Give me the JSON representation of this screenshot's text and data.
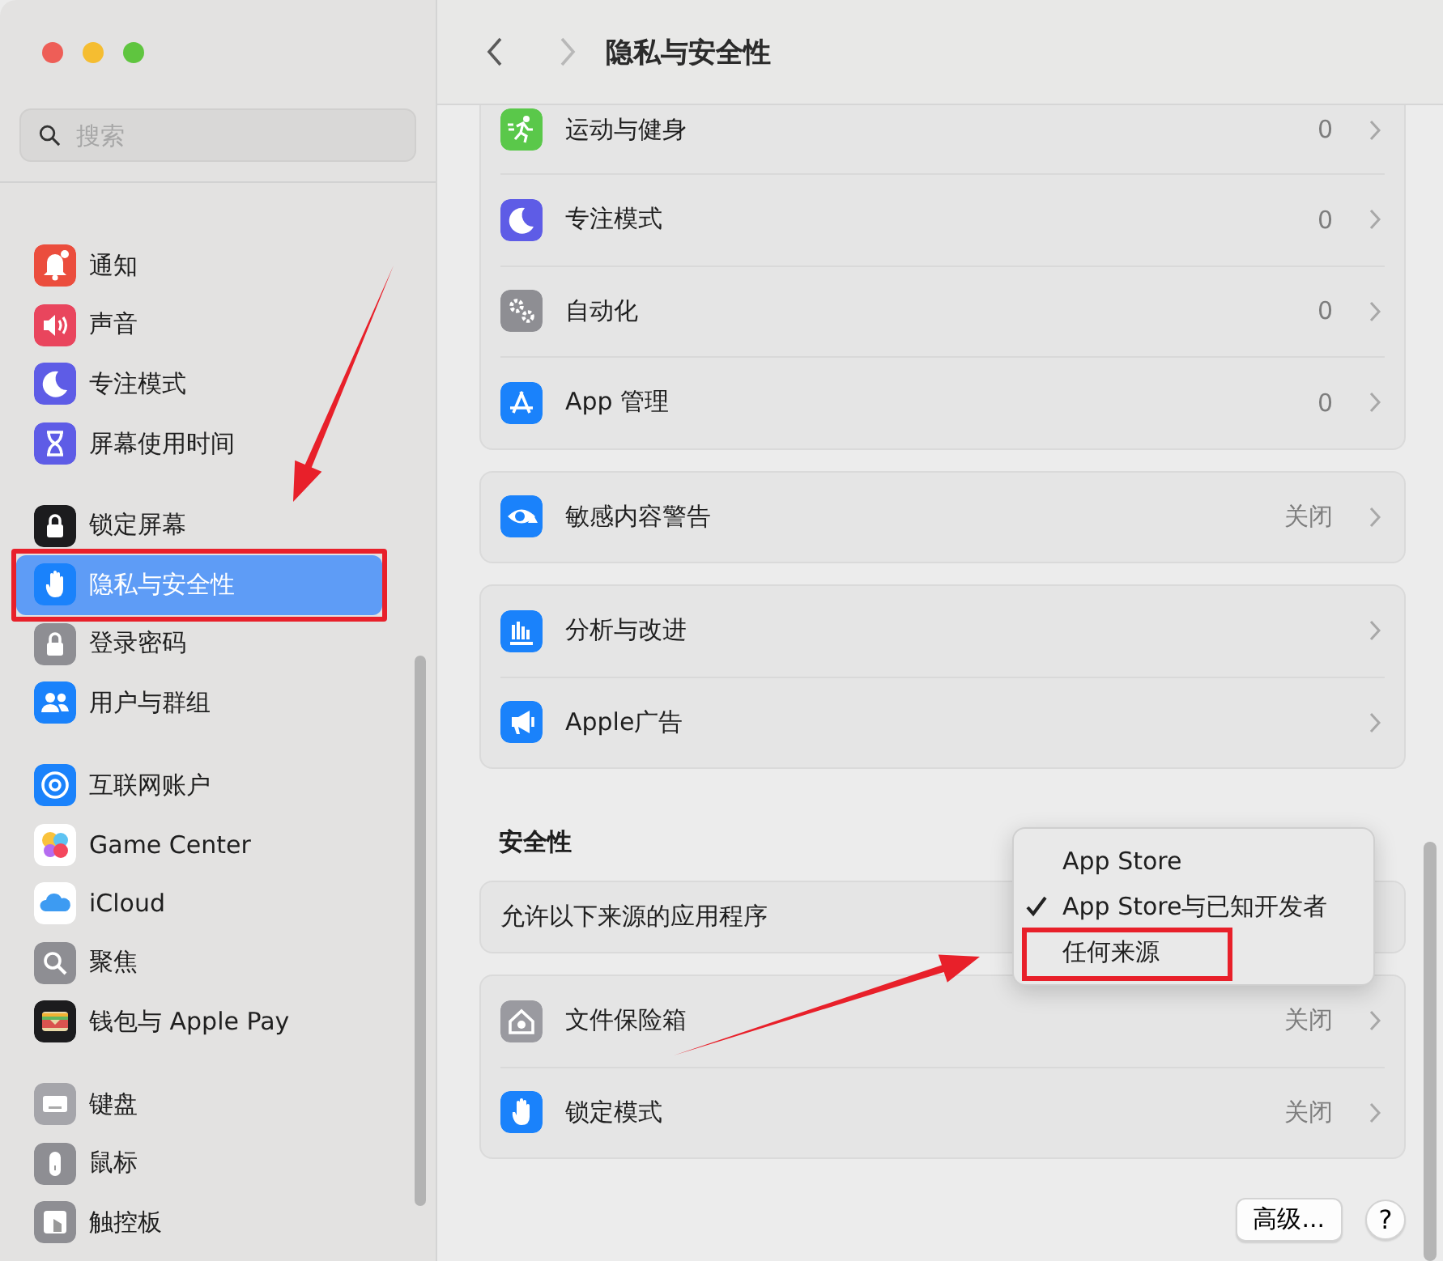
{
  "window": {
    "controls": [
      {
        "kind": "close"
      },
      {
        "kind": "minimize"
      },
      {
        "kind": "zoom"
      }
    ]
  },
  "sidebar": {
    "search": {
      "placeholder": "搜索"
    },
    "groups": [
      {
        "items": [
          {
            "label": "通知",
            "selected": false,
            "marked": false
          },
          {
            "label": "声音",
            "selected": false,
            "marked": false
          },
          {
            "label": "专注模式",
            "selected": false,
            "marked": false
          },
          {
            "label": "屏幕使用时间",
            "selected": false,
            "marked": false
          }
        ]
      },
      {
        "items": [
          {
            "label": "锁定屏幕",
            "selected": false,
            "marked": false
          },
          {
            "label": "隐私与安全性",
            "selected": true,
            "marked": true
          },
          {
            "label": "登录密码",
            "selected": false,
            "marked": false
          },
          {
            "label": "用户与群组",
            "selected": false,
            "marked": false
          }
        ]
      },
      {
        "items": [
          {
            "label": "互联网账户",
            "selected": false,
            "marked": false
          },
          {
            "label": "Game Center",
            "selected": false,
            "marked": false
          },
          {
            "label": "iCloud",
            "selected": false,
            "marked": false
          },
          {
            "label": "聚焦",
            "selected": false,
            "marked": false
          },
          {
            "label": "钱包与 Apple Pay",
            "selected": false,
            "marked": false
          }
        ]
      },
      {
        "items": [
          {
            "label": "键盘",
            "selected": false,
            "marked": false
          },
          {
            "label": "鼠标",
            "selected": false,
            "marked": false
          },
          {
            "label": "触控板",
            "selected": false,
            "marked": false
          }
        ]
      }
    ]
  },
  "toolbar": {
    "back": {
      "disabled": false
    },
    "forward": {
      "disabled": true
    },
    "title": "隐私与安全性"
  },
  "sections": [
    {
      "cards": [
        {
          "rows": [
            {
              "kind": "link",
              "label": "运动与健身",
              "value": "0"
            },
            {
              "kind": "link",
              "label": "专注模式",
              "value": "0"
            },
            {
              "kind": "link",
              "label": "自动化",
              "value": "0"
            },
            {
              "kind": "link",
              "label": "App 管理",
              "value": "0"
            }
          ]
        },
        {
          "rows": [
            {
              "kind": "link",
              "label": "敏感内容警告",
              "value": "关闭"
            }
          ]
        },
        {
          "rows": [
            {
              "kind": "link",
              "label": "分析与改进"
            },
            {
              "kind": "link",
              "label": "Apple广告"
            }
          ]
        }
      ]
    },
    {
      "heading": "安全性",
      "cards": [
        {
          "rows": [
            {
              "kind": "popup",
              "label": "允许以下来源的应用程序"
            }
          ]
        },
        {
          "rows": [
            {
              "kind": "link",
              "label": "文件保险箱",
              "value": "关闭"
            },
            {
              "kind": "link",
              "label": "锁定模式",
              "value": "关闭"
            }
          ]
        }
      ]
    }
  ],
  "popup_menu": {
    "options": [
      {
        "label": "App Store",
        "selected": false,
        "marked": false
      },
      {
        "label": "App Store与已知开发者",
        "selected": true,
        "marked": false
      },
      {
        "label": "任何来源",
        "selected": false,
        "marked": true
      }
    ]
  },
  "footer": {
    "buttons": [
      {
        "kind": "text",
        "label": "高级..."
      },
      {
        "kind": "help",
        "label": "?"
      }
    ]
  }
}
